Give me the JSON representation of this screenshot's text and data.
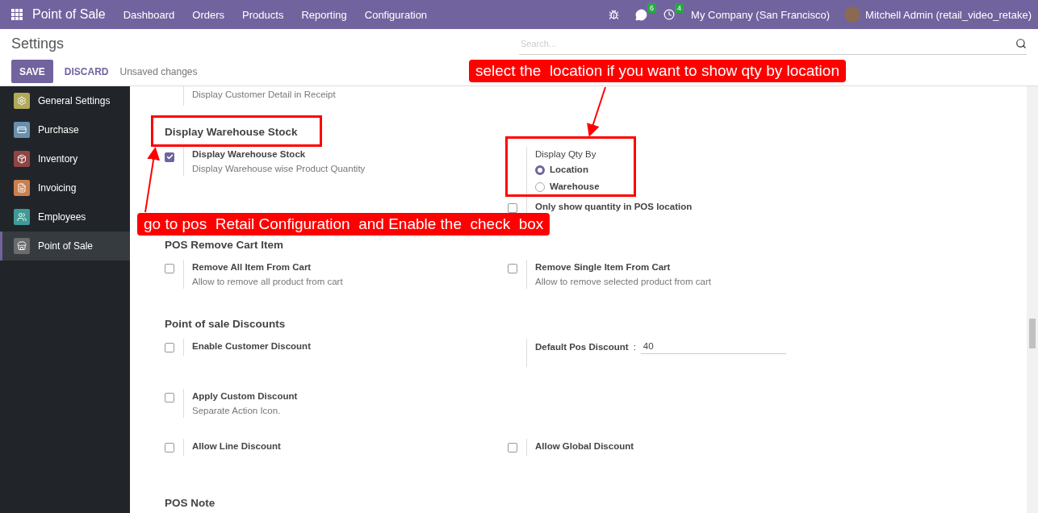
{
  "navbar": {
    "app": "Point of Sale",
    "menu": [
      "Dashboard",
      "Orders",
      "Products",
      "Reporting",
      "Configuration"
    ],
    "messages_count": "6",
    "activities_count": "4",
    "company": "My Company (San Francisco)",
    "user": "Mitchell Admin (retail_video_retake)"
  },
  "control_panel": {
    "title": "Settings",
    "search": {
      "placeholder": "Search..."
    },
    "save": "SAVE",
    "discard": "DISCARD",
    "status": "Unsaved changes"
  },
  "sidebar": {
    "items": [
      {
        "label": "General Settings",
        "color": "#b1a95a",
        "selected": false
      },
      {
        "label": "Purchase",
        "color": "#6a8fae",
        "selected": false
      },
      {
        "label": "Inventory",
        "color": "#8f4545",
        "selected": false
      },
      {
        "label": "Invoicing",
        "color": "#c9804f",
        "selected": false
      },
      {
        "label": "Employees",
        "color": "#3f9a96",
        "selected": false
      },
      {
        "label": "Point of Sale",
        "color": "#6b6b6b",
        "selected": true
      }
    ]
  },
  "settings": {
    "leading_description": "Display Customer Detail in Receipt",
    "sections": [
      {
        "title": "Display Warehouse Stock",
        "rows": [
          {
            "left": [
              {
                "kind": "checkbox",
                "checked": true,
                "label": "Display Warehouse Stock",
                "description": "Display Warehouse wise Product Quantity"
              }
            ],
            "right": [
              {
                "kind": "radio",
                "label": "Display Qty By",
                "options": [
                  {
                    "label": "Location",
                    "selected": true
                  },
                  {
                    "label": "Warehouse",
                    "selected": false
                  }
                ]
              },
              {
                "kind": "checkbox",
                "checked": false,
                "label": "Only show quantity in POS location"
              }
            ]
          }
        ]
      },
      {
        "title": "POS Remove Cart Item",
        "rows": [
          {
            "left": [
              {
                "kind": "checkbox",
                "checked": false,
                "label": "Remove All Item From Cart",
                "description": "Allow to remove all product from cart"
              }
            ],
            "right": [
              {
                "kind": "checkbox",
                "checked": false,
                "label": "Remove Single Item From Cart",
                "description": "Allow to remove selected product from cart"
              }
            ]
          }
        ]
      },
      {
        "title": "Point of sale Discounts",
        "rows": [
          {
            "left": [
              {
                "kind": "checkbox",
                "checked": false,
                "label": "Enable Customer Discount"
              }
            ],
            "right": [
              {
                "kind": "field",
                "label": "Default Pos Discount",
                "separator": ":",
                "value": "40"
              }
            ]
          },
          {
            "left": [
              {
                "kind": "checkbox",
                "checked": false,
                "label": "Apply Custom Discount",
                "description": "Separate Action Icon."
              }
            ],
            "right": []
          },
          {
            "left": [
              {
                "kind": "checkbox",
                "checked": false,
                "label": "Allow Line Discount"
              }
            ],
            "right": [
              {
                "kind": "checkbox",
                "checked": false,
                "label": "Allow Global Discount"
              }
            ]
          }
        ]
      },
      {
        "title": "POS Note"
      }
    ]
  },
  "annotations": [
    "select the  location if you want to show qty by location",
    "go to pos  Retail Configuration  and Enable the  check  box"
  ]
}
